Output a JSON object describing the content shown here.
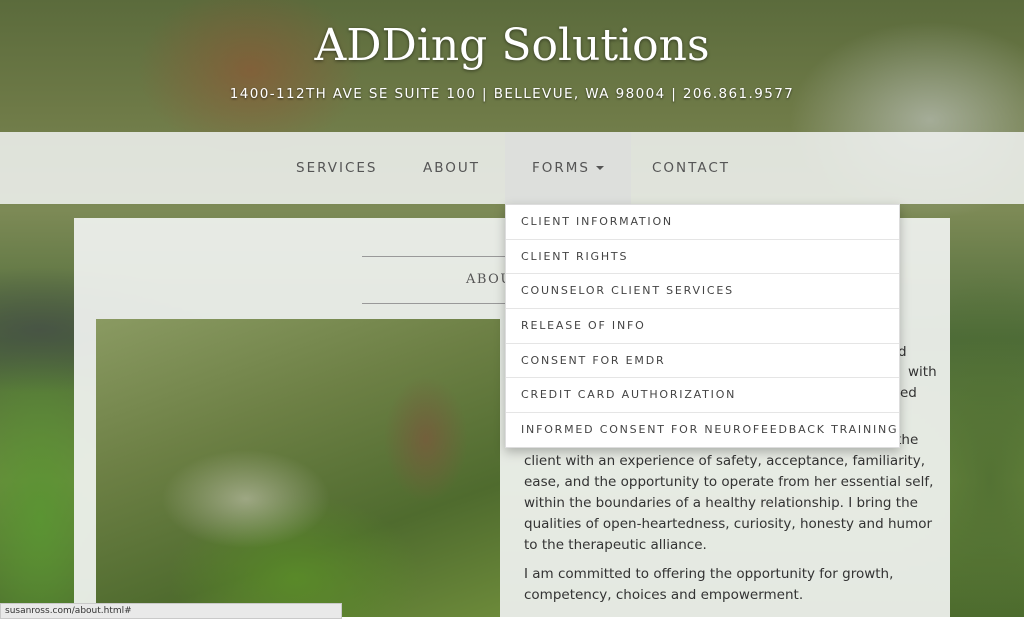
{
  "site": {
    "title": "ADDing Solutions",
    "address": "1400-112TH AVE SE SUITE 100 | BELLEVUE, WA 98004 | 206.861.9577"
  },
  "nav": {
    "services": "SERVICES",
    "about": "ABOUT",
    "forms": "FORMS",
    "contact": "CONTACT"
  },
  "forms_menu": [
    "CLIENT INFORMATION",
    "CLIENT RIGHTS",
    "COUNSELOR CLIENT SERVICES",
    "RELEASE OF INFO",
    "CONSENT FOR EMDR",
    "CREDIT CARD AUTHORIZATION",
    "INFORMED CONSENT FOR NEUROFEEDBACK TRAINING"
  ],
  "panel": {
    "heading_visible": "ABOU",
    "partial_lines": [
      "d",
      "with",
      "ed"
    ],
    "paragraphs": [
      "The most essential elements of therapy are to provide the client with an experience of safety, acceptance, familiarity, ease, and the opportunity to operate from her essential self, within the boundaries of a healthy relationship. I bring the qualities of open-heartedness, curiosity, honesty and humor to the therapeutic alliance.",
      "I am committed to offering the opportunity for growth, competency, choices and empowerment."
    ]
  },
  "status_bar": {
    "url": "susanross.com/about.html#"
  },
  "colors": {
    "nav_text": "#555555",
    "title": "#ffffff"
  }
}
